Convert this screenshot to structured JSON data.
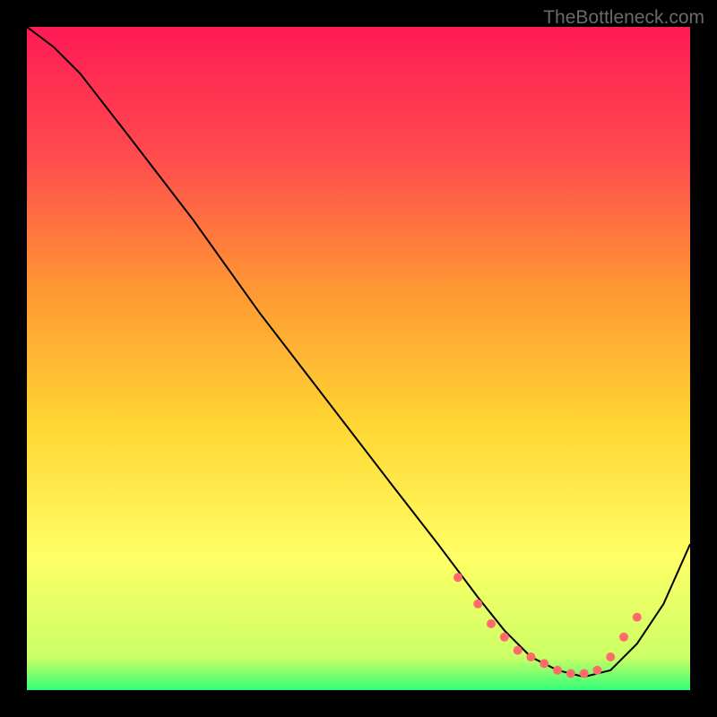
{
  "watermark": "TheBottleneck.com",
  "chart_data": {
    "type": "line",
    "title": "",
    "xlabel": "",
    "ylabel": "",
    "ylim": [
      0,
      100
    ],
    "xlim": [
      0,
      100
    ],
    "gradient_stops": [
      {
        "offset": 0,
        "color": "#ff1a55"
      },
      {
        "offset": 20,
        "color": "#ff4d4d"
      },
      {
        "offset": 40,
        "color": "#ff9933"
      },
      {
        "offset": 60,
        "color": "#ffd633"
      },
      {
        "offset": 80,
        "color": "#ffff66"
      },
      {
        "offset": 95,
        "color": "#ccff66"
      },
      {
        "offset": 100,
        "color": "#33ff77"
      }
    ],
    "series": [
      {
        "name": "curve",
        "x": [
          0,
          4,
          8,
          15,
          25,
          35,
          45,
          55,
          62,
          68,
          72,
          76,
          80,
          84,
          88,
          92,
          96,
          100
        ],
        "y": [
          100,
          97,
          93,
          84,
          71,
          57,
          44,
          31,
          22,
          14,
          9,
          5,
          3,
          2,
          3,
          7,
          13,
          22
        ]
      }
    ],
    "dots": {
      "name": "highlight-dots",
      "x": [
        65,
        68,
        70,
        72,
        74,
        76,
        78,
        80,
        82,
        84,
        86,
        88,
        90,
        92
      ],
      "y": [
        17,
        13,
        10,
        8,
        6,
        5,
        4,
        3,
        2.5,
        2.5,
        3,
        5,
        8,
        11
      ],
      "color": "#ff6b6b"
    }
  }
}
